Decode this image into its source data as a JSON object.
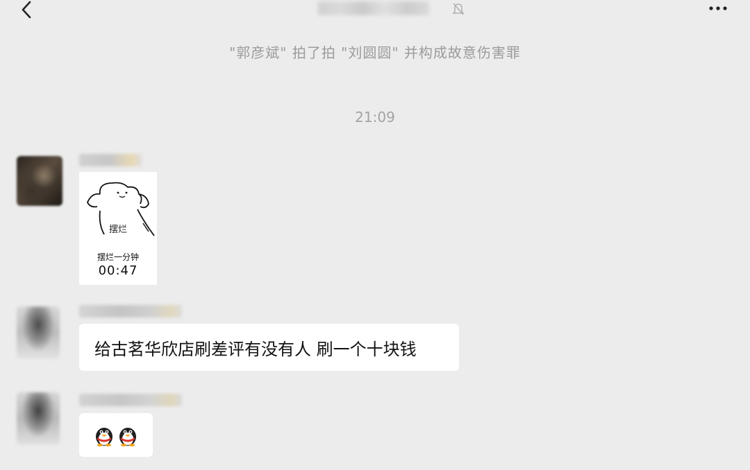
{
  "header": {
    "back_icon": "chevron-left-icon",
    "mute_icon": "bell-off-icon",
    "more_icon": "more-dots-icon"
  },
  "system_note": "\"郭彦斌\" 拍了拍 \"刘圆圆\" 并构成故意伤害罪",
  "timestamp": "21:09",
  "messages": [
    {
      "type": "sticker",
      "sticker_label": "摆烂",
      "sticker_caption": "摆烂一分钟",
      "sticker_timer": "00:47"
    },
    {
      "type": "text",
      "text": "给古茗华欣店刷差评有没有人 刷一个十块钱"
    },
    {
      "type": "emoji",
      "emoji_icons": [
        "qq-penguin-icon",
        "qq-penguin-icon"
      ]
    }
  ],
  "colors": {
    "background": "#ececec",
    "bubble": "#ffffff",
    "system_text": "#9b9b9b",
    "qq_red": "#d9312b"
  }
}
